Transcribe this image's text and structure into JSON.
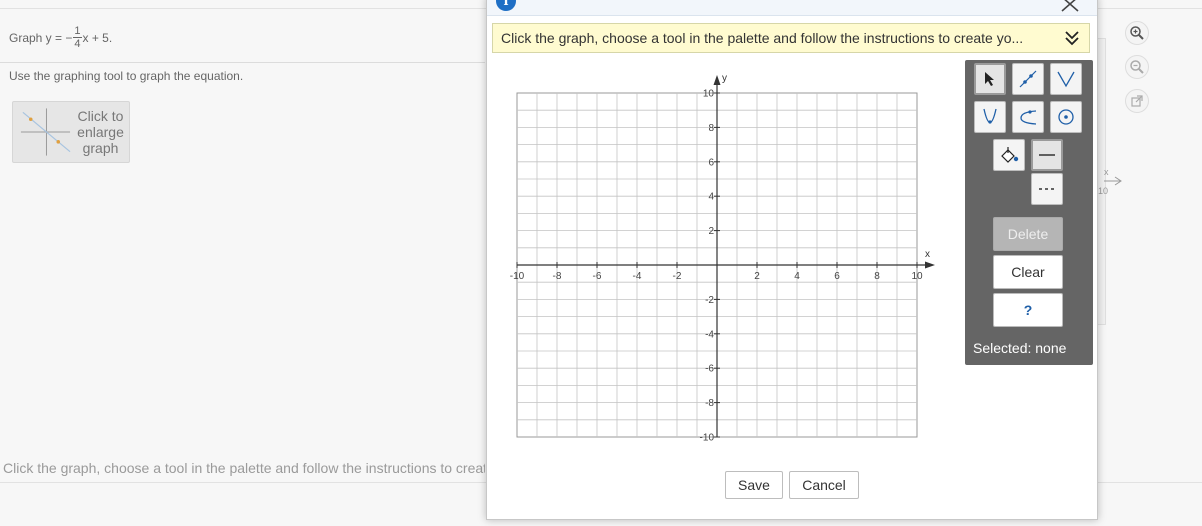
{
  "question": {
    "prefix": "Graph y = −",
    "frac_num": "1",
    "frac_den": "4",
    "suffix": "x + 5.",
    "instruction": "Use the graphing tool to graph the equation.",
    "enlarge_label": "Click to enlarge graph",
    "bottom_instruction": "Click the graph, choose a tool in the palette and follow the instructions to create your graph."
  },
  "background_axis": {
    "x_label": "x",
    "tick": "10"
  },
  "dialog": {
    "banner_text": "Click the graph, choose a tool in the palette and follow the instructions to create yo...",
    "save_label": "Save",
    "cancel_label": "Cancel"
  },
  "graph": {
    "x_label": "x",
    "y_label": "y",
    "xlim": [
      -10,
      10
    ],
    "ylim": [
      -10,
      10
    ],
    "x_ticks": [
      "-10",
      "-8",
      "-6",
      "-4",
      "-2",
      "2",
      "4",
      "6",
      "8",
      "10"
    ],
    "y_ticks": [
      "10",
      "8",
      "6",
      "4",
      "2",
      "-2",
      "-4",
      "-6",
      "-8",
      "-10"
    ]
  },
  "palette": {
    "tools": [
      "pointer-icon",
      "line-icon",
      "absolute-value-icon",
      "parabola-icon",
      "exponential-icon",
      "circle-icon",
      "fill-icon",
      "solid-line-icon",
      "dashed-line-icon"
    ],
    "delete_label": "Delete",
    "clear_label": "Clear",
    "help_label": "?",
    "selected_text": "Selected: none"
  },
  "colors": {
    "info": "#1f6fc5",
    "banner": "#fffbd0",
    "palette": "#656565",
    "tool_accent": "#1f5fa8"
  }
}
